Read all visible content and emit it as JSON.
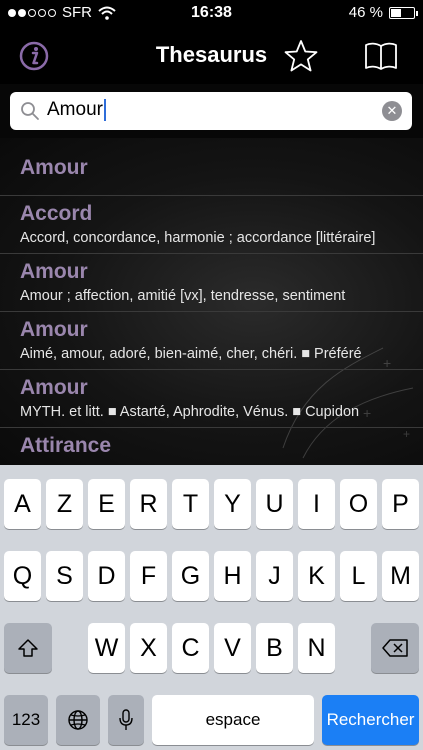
{
  "status": {
    "carrier": "SFR",
    "time": "16:38",
    "battery_text": "46 %",
    "battery_level": 0.46,
    "signal_bars_filled": 2,
    "signal_bars_total": 5
  },
  "nav": {
    "title": "Thesaurus",
    "icons": [
      "info-icon",
      "star-icon",
      "book-icon"
    ]
  },
  "search": {
    "value": "Amour"
  },
  "results": [
    {
      "title": "Amour",
      "subtitle": ""
    },
    {
      "title": "Accord",
      "subtitle": "Accord, concordance, harmonie ;  accordance [littéraire]"
    },
    {
      "title": "Amour",
      "subtitle": "Amour ;  affection, amitié [vx], tendresse, sentiment"
    },
    {
      "title": "Amour",
      "subtitle": "Aimé, amour, adoré, bien-aimé, cher, chéri. ■ Préféré"
    },
    {
      "title": "Amour",
      "subtitle": "MYTH. et litt. ■ Astarté, Aphrodite, Vénus. ■ Cupidon"
    },
    {
      "title": "Attirance",
      "subtitle": ""
    }
  ],
  "keyboard": {
    "row1": [
      "A",
      "Z",
      "E",
      "R",
      "T",
      "Y",
      "U",
      "I",
      "O",
      "P"
    ],
    "row2": [
      "Q",
      "S",
      "D",
      "F",
      "G",
      "H",
      "J",
      "K",
      "L",
      "M"
    ],
    "row3": [
      "W",
      "X",
      "C",
      "V",
      "B",
      "N"
    ],
    "numbers_label": "123",
    "space_label": "espace",
    "return_label": "Rechercher"
  },
  "colors": {
    "result_title": "#9a86ad",
    "accent": "#1b7ff5"
  }
}
